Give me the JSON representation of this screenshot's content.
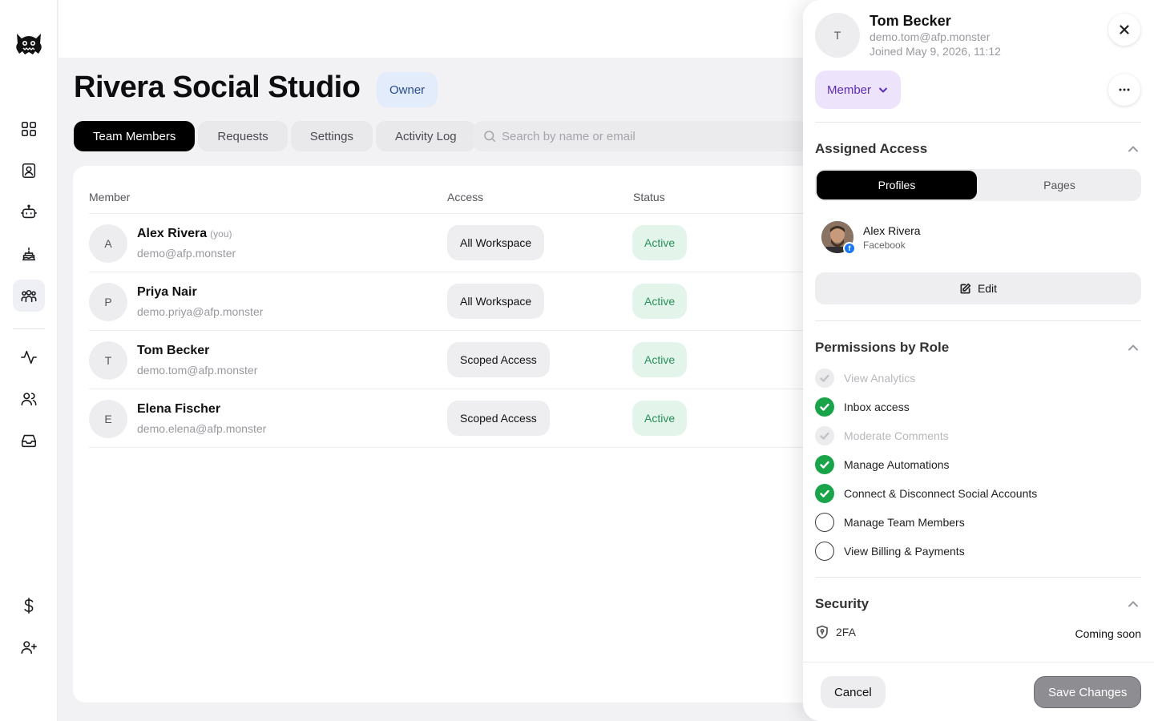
{
  "sidebar": {
    "icons": [
      "logo-monster",
      "dashboard-grid-icon",
      "contact-card-icon",
      "bot-icon",
      "cake-icon",
      "team-icon",
      "activity-icon",
      "users-icon",
      "inbox-icon",
      "dollar-icon",
      "add-user-icon"
    ]
  },
  "main": {
    "title": "Rivera Social Studio",
    "owner_badge": "Owner",
    "tabs": [
      "Team Members",
      "Requests",
      "Settings",
      "Activity Log"
    ],
    "search_placeholder": "Search by name or email",
    "columns": [
      "Member",
      "Access",
      "Status"
    ],
    "rows": [
      {
        "initial": "A",
        "name": "Alex Rivera",
        "you": "(you)",
        "email": "demo@afp.monster",
        "access": "All Workspace",
        "status": "Active"
      },
      {
        "initial": "P",
        "name": "Priya Nair",
        "you": "",
        "email": "demo.priya@afp.monster",
        "access": "All Workspace",
        "status": "Active"
      },
      {
        "initial": "T",
        "name": "Tom Becker",
        "you": "",
        "email": "demo.tom@afp.monster",
        "access": "Scoped Access",
        "status": "Active"
      },
      {
        "initial": "E",
        "name": "Elena Fischer",
        "you": "",
        "email": "demo.elena@afp.monster",
        "access": "Scoped Access",
        "status": "Active"
      }
    ]
  },
  "panel": {
    "initial": "T",
    "name": "Tom Becker",
    "email": "demo.tom@afp.monster",
    "joined": "Joined May 9, 2026, 11:12",
    "role": "Member",
    "assigned_title": "Assigned Access",
    "seg": [
      "Profiles",
      "Pages"
    ],
    "profile": {
      "name": "Alex Rivera",
      "network": "Facebook",
      "badge": "f"
    },
    "edit_label": "Edit",
    "permissions_title": "Permissions by Role",
    "permissions": [
      {
        "label": "View Analytics",
        "state": "disabled"
      },
      {
        "label": "Inbox access",
        "state": "on"
      },
      {
        "label": "Moderate Comments",
        "state": "disabled"
      },
      {
        "label": "Manage Automations",
        "state": "on"
      },
      {
        "label": "Connect & Disconnect Social Accounts",
        "state": "on"
      },
      {
        "label": "Manage Team Members",
        "state": "off"
      },
      {
        "label": "View Billing & Payments",
        "state": "off"
      }
    ],
    "security_title": "Security",
    "twofa_label": "2FA",
    "twofa_status": "Coming soon",
    "cancel_label": "Cancel",
    "save_label": "Save Changes"
  }
}
